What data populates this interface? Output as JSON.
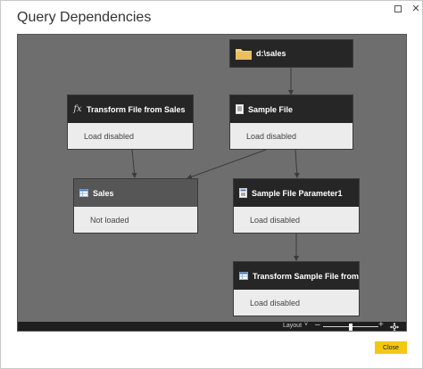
{
  "dialog": {
    "title": "Query Dependencies",
    "maximize_icon": "maximize-icon",
    "close_icon": "close-icon"
  },
  "nodes": [
    {
      "id": "dsales",
      "title": "d:\\sales",
      "icon": "folder-icon",
      "status": ""
    },
    {
      "id": "transform-file",
      "title": "Transform File from Sales",
      "icon": "function-icon",
      "status": "Load disabled"
    },
    {
      "id": "sample-file",
      "title": "Sample File",
      "icon": "document-icon",
      "status": "Load disabled"
    },
    {
      "id": "sales",
      "title": "Sales",
      "icon": "table-icon",
      "status": "Not loaded",
      "selected": true
    },
    {
      "id": "sample-file-parameter",
      "title": "Sample File Parameter1",
      "icon": "parameter-icon",
      "status": "Load disabled"
    },
    {
      "id": "transform-sample",
      "title": "Transform Sample File from...",
      "icon": "table-icon",
      "status": "Load disabled"
    }
  ],
  "statusbar": {
    "layout_label": "Layout",
    "layout_caret": "˅",
    "zoom_minus": "–",
    "zoom_plus": "+",
    "fit_icon": "fit-to-screen-icon"
  },
  "footer": {
    "close_label": "Close"
  },
  "colors": {
    "canvas": "#6e6e6e",
    "node_header": "#262626",
    "node_header_selected": "#565656",
    "node_body": "#ececec",
    "accent_button": "#f2c811",
    "edge": "#3a3a3a"
  }
}
